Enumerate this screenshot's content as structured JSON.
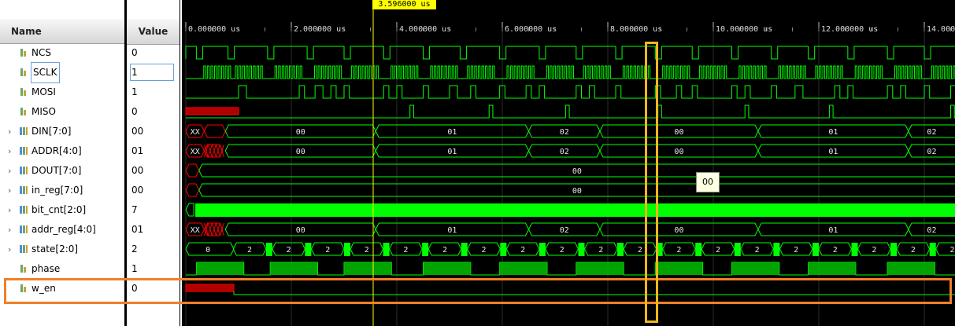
{
  "header": {
    "name_label": "Name",
    "value_label": "Value"
  },
  "cursor": {
    "time_label": "3.596000 us"
  },
  "timeline": {
    "ticks": [
      "0.000000 us",
      "2.000000 us",
      "4.000000 us",
      "6.000000 us",
      "8.000000 us",
      "10.000000 us",
      "12.000000 us",
      "14.000000 us"
    ]
  },
  "signals": [
    {
      "name": "NCS",
      "value": "0",
      "kind": "bit"
    },
    {
      "name": "SCLK",
      "value": "1",
      "kind": "bit"
    },
    {
      "name": "MOSI",
      "value": "1",
      "kind": "bit"
    },
    {
      "name": "MISO",
      "value": "0",
      "kind": "bit"
    },
    {
      "name": "DIN[7:0]",
      "value": "00",
      "kind": "bus"
    },
    {
      "name": "ADDR[4:0]",
      "value": "01",
      "kind": "bus"
    },
    {
      "name": "DOUT[7:0]",
      "value": "00",
      "kind": "bus"
    },
    {
      "name": "in_reg[7:0]",
      "value": "00",
      "kind": "bus"
    },
    {
      "name": "bit_cnt[2:0]",
      "value": "7",
      "kind": "bus"
    },
    {
      "name": "addr_reg[4:0]",
      "value": "01",
      "kind": "bus"
    },
    {
      "name": "state[2:0]",
      "value": "2",
      "kind": "bus"
    },
    {
      "name": "phase",
      "value": "1",
      "kind": "bit"
    },
    {
      "name": "w_en",
      "value": "0",
      "kind": "bit"
    }
  ],
  "bus_labels": {
    "din": [
      "XX",
      "00",
      "01",
      "02",
      "00",
      "01",
      "02"
    ],
    "addr": [
      "XX",
      "00",
      "01",
      "02",
      "00",
      "01",
      "02"
    ],
    "dout": [
      "00"
    ],
    "in_reg": [
      "00"
    ],
    "addr_reg": [
      "XX",
      "00",
      "01",
      "02",
      "00",
      "01",
      "02"
    ],
    "state": [
      "0",
      "2"
    ]
  },
  "tooltip": {
    "text": "00"
  },
  "colors": {
    "wave": "#00ff00",
    "undefined": "#ff0000",
    "cursor": "#ffff00",
    "highlight_orange": "#f07f2a",
    "highlight_yellow": "#f0b71c"
  }
}
